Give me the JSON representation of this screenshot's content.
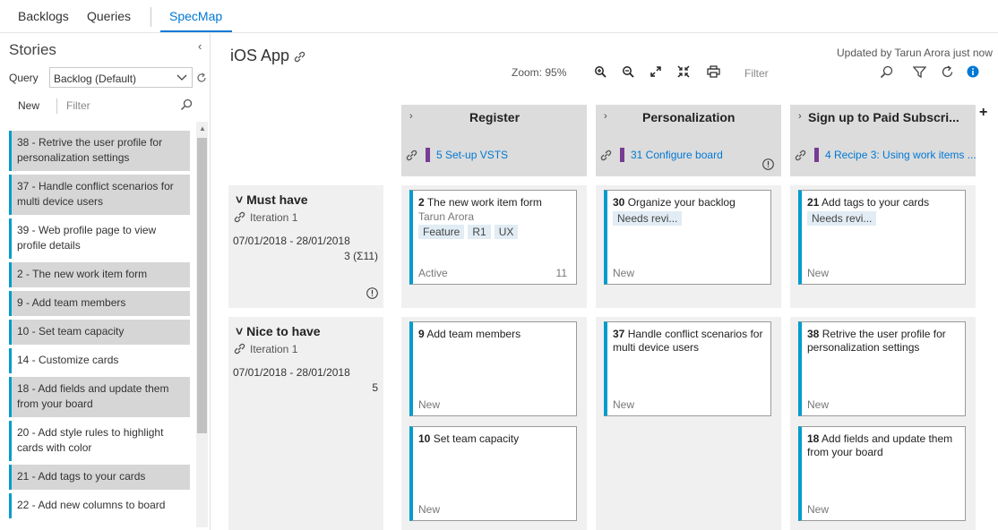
{
  "nav": {
    "tabs": [
      "Backlogs",
      "Queries",
      "SpecMap"
    ],
    "active": "SpecMap"
  },
  "sidebar": {
    "title": "Stories",
    "query_label": "Query",
    "query_value": "Backlog (Default)",
    "new_label": "New",
    "filter_placeholder": "Filter",
    "items": [
      {
        "text": "38 - Retrive the user profile for personalization settings",
        "selected": true
      },
      {
        "text": "37 - Handle conflict scenarios for multi device users",
        "selected": true
      },
      {
        "text": "39 - Web profile page to view profile details",
        "selected": false
      },
      {
        "text": "2 - The new work item form",
        "selected": true
      },
      {
        "text": "9 - Add team members",
        "selected": true
      },
      {
        "text": "10 - Set team capacity",
        "selected": true
      },
      {
        "text": "14 - Customize cards",
        "selected": false
      },
      {
        "text": "18 - Add fields and update them from your board",
        "selected": true
      },
      {
        "text": "20 - Add style rules to highlight cards with color",
        "selected": false
      },
      {
        "text": "21 - Add tags to your cards",
        "selected": true
      },
      {
        "text": "22 - Add new columns to board",
        "selected": false
      }
    ]
  },
  "main": {
    "title": "iOS App",
    "updated": "Updated by Tarun Arora just now",
    "zoom": "Zoom:  95%",
    "filter_placeholder": "Filter"
  },
  "columns": [
    {
      "name": "Register",
      "link_text": "5 Set-up VSTS",
      "has_info": false
    },
    {
      "name": "Personalization",
      "link_text": "31 Configure board",
      "has_info": true
    },
    {
      "name": "Sign up to Paid Subscri...",
      "link_text": "4 Recipe 3: Using work items ...",
      "has_info": false
    }
  ],
  "rows": [
    {
      "title": "Must have",
      "iteration": "Iteration 1",
      "dates": "07/01/2018 - 28/01/2018",
      "count": "3 (Σ11)",
      "has_info": true
    },
    {
      "title": "Nice to have",
      "iteration": "Iteration 1",
      "dates": "07/01/2018 - 28/01/2018",
      "count": "5",
      "has_info": false
    }
  ],
  "cards": {
    "c00": {
      "id": "2",
      "title": "The new work item form",
      "assignee": "Tarun Arora",
      "tags": [
        "Feature",
        "R1",
        "UX"
      ],
      "state": "Active",
      "effort": "11"
    },
    "c01": {
      "id": "30",
      "title": "Organize your backlog",
      "tags": [
        "Needs revi..."
      ],
      "state": "New"
    },
    "c02": {
      "id": "21",
      "title": "Add tags to your cards",
      "tags": [
        "Needs revi..."
      ],
      "state": "New"
    },
    "c10": {
      "id": "9",
      "title": "Add team members",
      "state": "New"
    },
    "c11": {
      "id": "37",
      "title": "Handle conflict scenarios for multi device users",
      "state": "New"
    },
    "c12": {
      "id": "38",
      "title": "Retrive the user profile for personalization settings",
      "state": "New"
    },
    "c20": {
      "id": "10",
      "title": "Set team capacity",
      "state": "New"
    },
    "c22": {
      "id": "18",
      "title": "Add fields and update them from your board",
      "state": "New"
    }
  },
  "colors": {
    "accent": "#0078d4",
    "story_bar": "#009ccc",
    "feature_bar": "#773b93",
    "selected_bg": "#d6d6d6",
    "lane_bg": "#f0f0f0",
    "header_bg": "#dcdcdc"
  }
}
